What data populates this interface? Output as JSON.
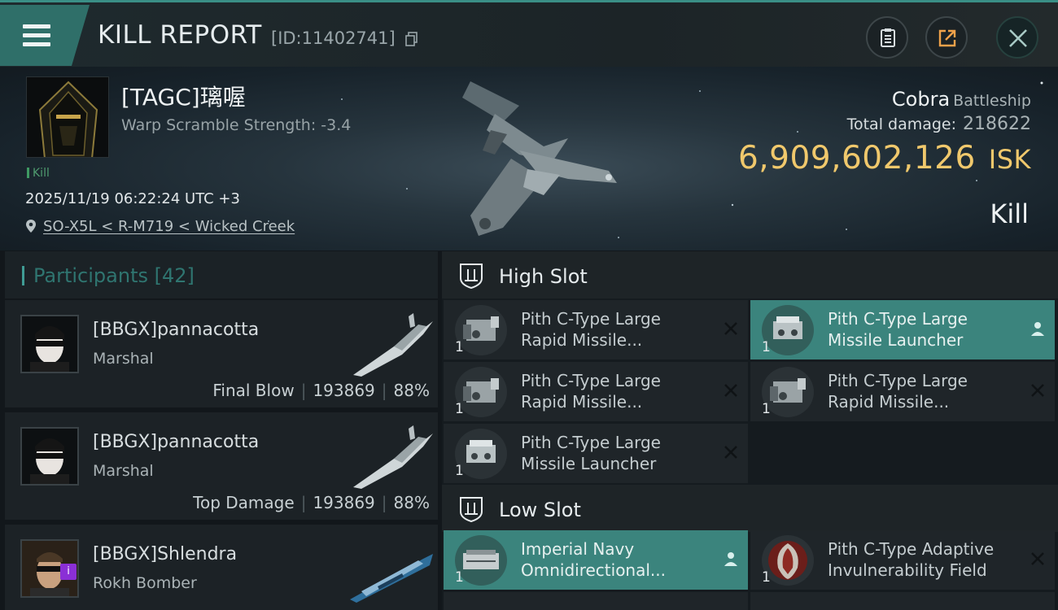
{
  "header": {
    "title": "KILL REPORT",
    "report_id": "[ID:11402741]"
  },
  "victim": {
    "name": "[TAGC]璃喔",
    "warp_scramble": "Warp Scramble Strength: -3.4",
    "tag": "Kill",
    "datetime": "2025/11/19 06:22:24 UTC +3",
    "location": "SO-X5L < R-M719 < Wicked Creek",
    "ship_name": "Cobra",
    "ship_class": "Battleship",
    "total_damage_label": "Total damage:",
    "total_damage": "218622",
    "isk_value": "6,909,602,126",
    "isk_unit": "ISK",
    "result": "Kill"
  },
  "participants": {
    "label": "Participants",
    "count": "[42]",
    "rows": [
      {
        "name": "[BBGX]pannacotta",
        "ship": "Marshal",
        "role": "Final Blow",
        "damage": "193869",
        "percent": "88%"
      },
      {
        "name": "[BBGX]pannacotta",
        "ship": "Marshal",
        "role": "Top Damage",
        "damage": "193869",
        "percent": "88%"
      },
      {
        "name": "[BBGX]Shlendra",
        "ship": "Rokh Bomber",
        "role": "",
        "damage": "",
        "percent": ""
      }
    ]
  },
  "fitting": {
    "high_slot_label": "High Slot",
    "low_slot_label": "Low Slot",
    "high_slot": [
      {
        "name_line1": "Pith C-Type Large",
        "name_line2": "Rapid Missile...",
        "qty": "1",
        "status": "destroyed"
      },
      {
        "name_line1": "Pith C-Type Large",
        "name_line2": "Missile Launcher",
        "qty": "1",
        "status": "dropped"
      },
      {
        "name_line1": "Pith C-Type Large",
        "name_line2": "Rapid Missile...",
        "qty": "1",
        "status": "destroyed"
      },
      {
        "name_line1": "Pith C-Type Large",
        "name_line2": "Rapid Missile...",
        "qty": "1",
        "status": "destroyed"
      },
      {
        "name_line1": "Pith C-Type Large",
        "name_line2": "Missile Launcher",
        "qty": "1",
        "status": "destroyed"
      }
    ],
    "low_slot": [
      {
        "name_line1": "Imperial Navy",
        "name_line2": "Omnidirectional...",
        "qty": "1",
        "status": "dropped"
      },
      {
        "name_line1": "Pith C-Type Adaptive",
        "name_line2": "Invulnerability Field",
        "qty": "1",
        "status": "destroyed"
      }
    ]
  },
  "colors": {
    "accent_teal": "#3b847d",
    "isk_gold": "#f0c86c",
    "kill_green": "#3f9a63",
    "badge_purple": "#8a2fd6"
  },
  "icons": [
    "menu-icon",
    "copy-icon",
    "clipboard-icon",
    "share-icon",
    "close-icon",
    "location-pin-icon",
    "slot-icon",
    "pilot-icon",
    "destroyed-x-icon",
    "info-badge-icon"
  ]
}
